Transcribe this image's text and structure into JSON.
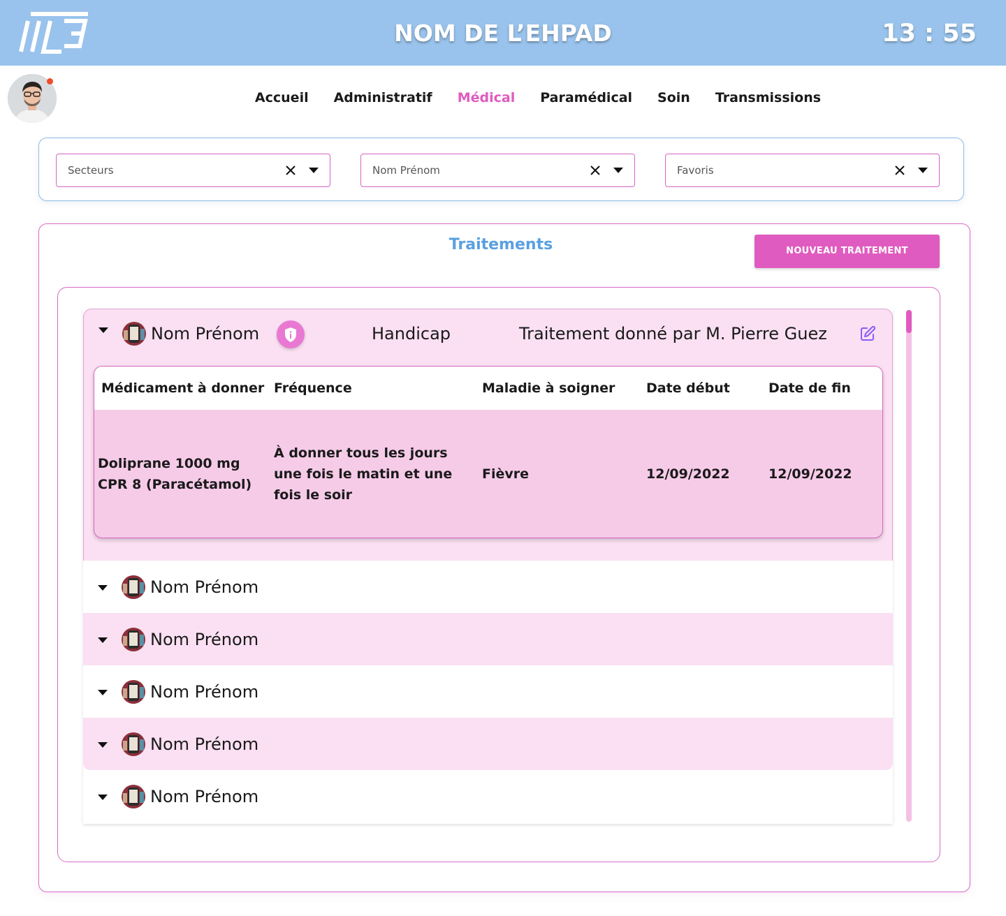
{
  "header": {
    "title": "NOM DE L’EHPAD",
    "clock": "13 : 55"
  },
  "nav": {
    "items": [
      "Accueil",
      "Administratif",
      "Médical",
      "Paramédical",
      "Soin",
      "Transmissions"
    ],
    "active": "Médical"
  },
  "filters": {
    "secteurs": "Secteurs",
    "nom_prenom": "Nom Prénom",
    "favoris": "Favoris"
  },
  "panel": {
    "title": "Traitements",
    "new_button": "NOUVEAU TRAITEMENT"
  },
  "expanded_row": {
    "name": "Nom Prénom",
    "condition": "Handicap",
    "given_by": "Traitement donné par M. Pierre Guez",
    "table": {
      "headers": [
        "Médicament à donner",
        "Fréquence",
        "Maladie à soigner",
        "Date début",
        "Date de fin"
      ],
      "row": {
        "medicament": "Doliprane 1000 mg CPR 8 (Paracétamol)",
        "frequence": "À donner tous les jours une fois le matin et une fois le soir",
        "maladie": "Fièvre",
        "date_debut": "12/09/2022",
        "date_fin": "12/09/2022"
      }
    }
  },
  "rows": [
    {
      "name": "Nom Prénom"
    },
    {
      "name": "Nom Prénom"
    },
    {
      "name": "Nom Prénom"
    },
    {
      "name": "Nom Prénom"
    },
    {
      "name": "Nom Prénom"
    }
  ],
  "colors": {
    "header_bg": "#99c3ec",
    "accent_pink": "#e05bbf",
    "title_blue": "#5aa0e0",
    "row_pink": "#fae0f2"
  },
  "icons": [
    "logo",
    "user-avatar",
    "close-icon",
    "chevron-down-icon",
    "patient-photo",
    "shield-info-icon",
    "edit-icon"
  ]
}
